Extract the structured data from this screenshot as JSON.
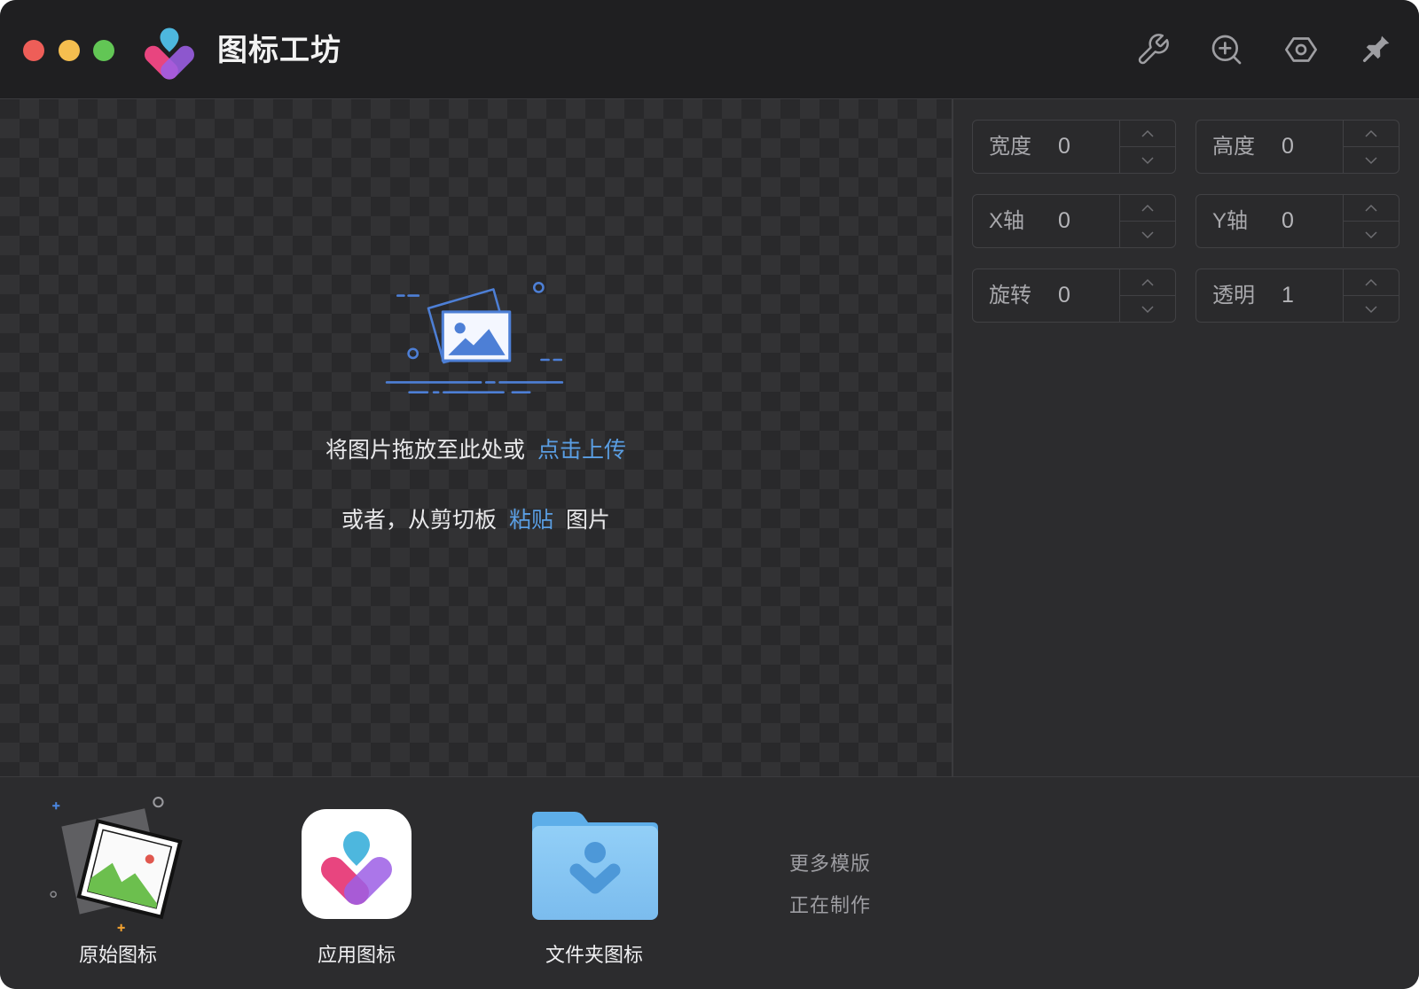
{
  "app": {
    "title": "图标工坊"
  },
  "titlebar": {
    "traffic_lights": [
      {
        "name": "close",
        "color": "#ee5e58"
      },
      {
        "name": "minimize",
        "color": "#f5be4f"
      },
      {
        "name": "maximize",
        "color": "#62c655"
      }
    ],
    "tools": [
      {
        "icon": "wrench-icon"
      },
      {
        "icon": "zoom-in-icon"
      },
      {
        "icon": "hexagon-settings-icon"
      },
      {
        "icon": "pin-icon"
      }
    ]
  },
  "dropzone": {
    "prompt_text": "将图片拖放至此处或",
    "upload_link": "点击上传",
    "paste_prefix": "或者，从剪切板",
    "paste_link": "粘贴",
    "paste_suffix": "图片",
    "illustration_icon": "image-placeholder-icon"
  },
  "properties": {
    "fields": [
      {
        "label": "宽度",
        "value": "0"
      },
      {
        "label": "高度",
        "value": "0"
      },
      {
        "label": "X轴",
        "value": "0"
      },
      {
        "label": "Y轴",
        "value": "0"
      },
      {
        "label": "旋转",
        "value": "0"
      },
      {
        "label": "透明",
        "value": "1"
      }
    ]
  },
  "templates": {
    "items": [
      {
        "label": "原始图标",
        "icon": "original-image-icon"
      },
      {
        "label": "应用图标",
        "icon": "app-icon"
      },
      {
        "label": "文件夹图标",
        "icon": "folder-icon"
      }
    ],
    "more_label": "更多模版",
    "status_label": "正在制作"
  },
  "colors": {
    "background": "#2c2c2e",
    "titlebar": "#1f1f21",
    "link": "#5a9ee3",
    "text": "#e8e8ea",
    "muted": "#a8a8ac"
  }
}
